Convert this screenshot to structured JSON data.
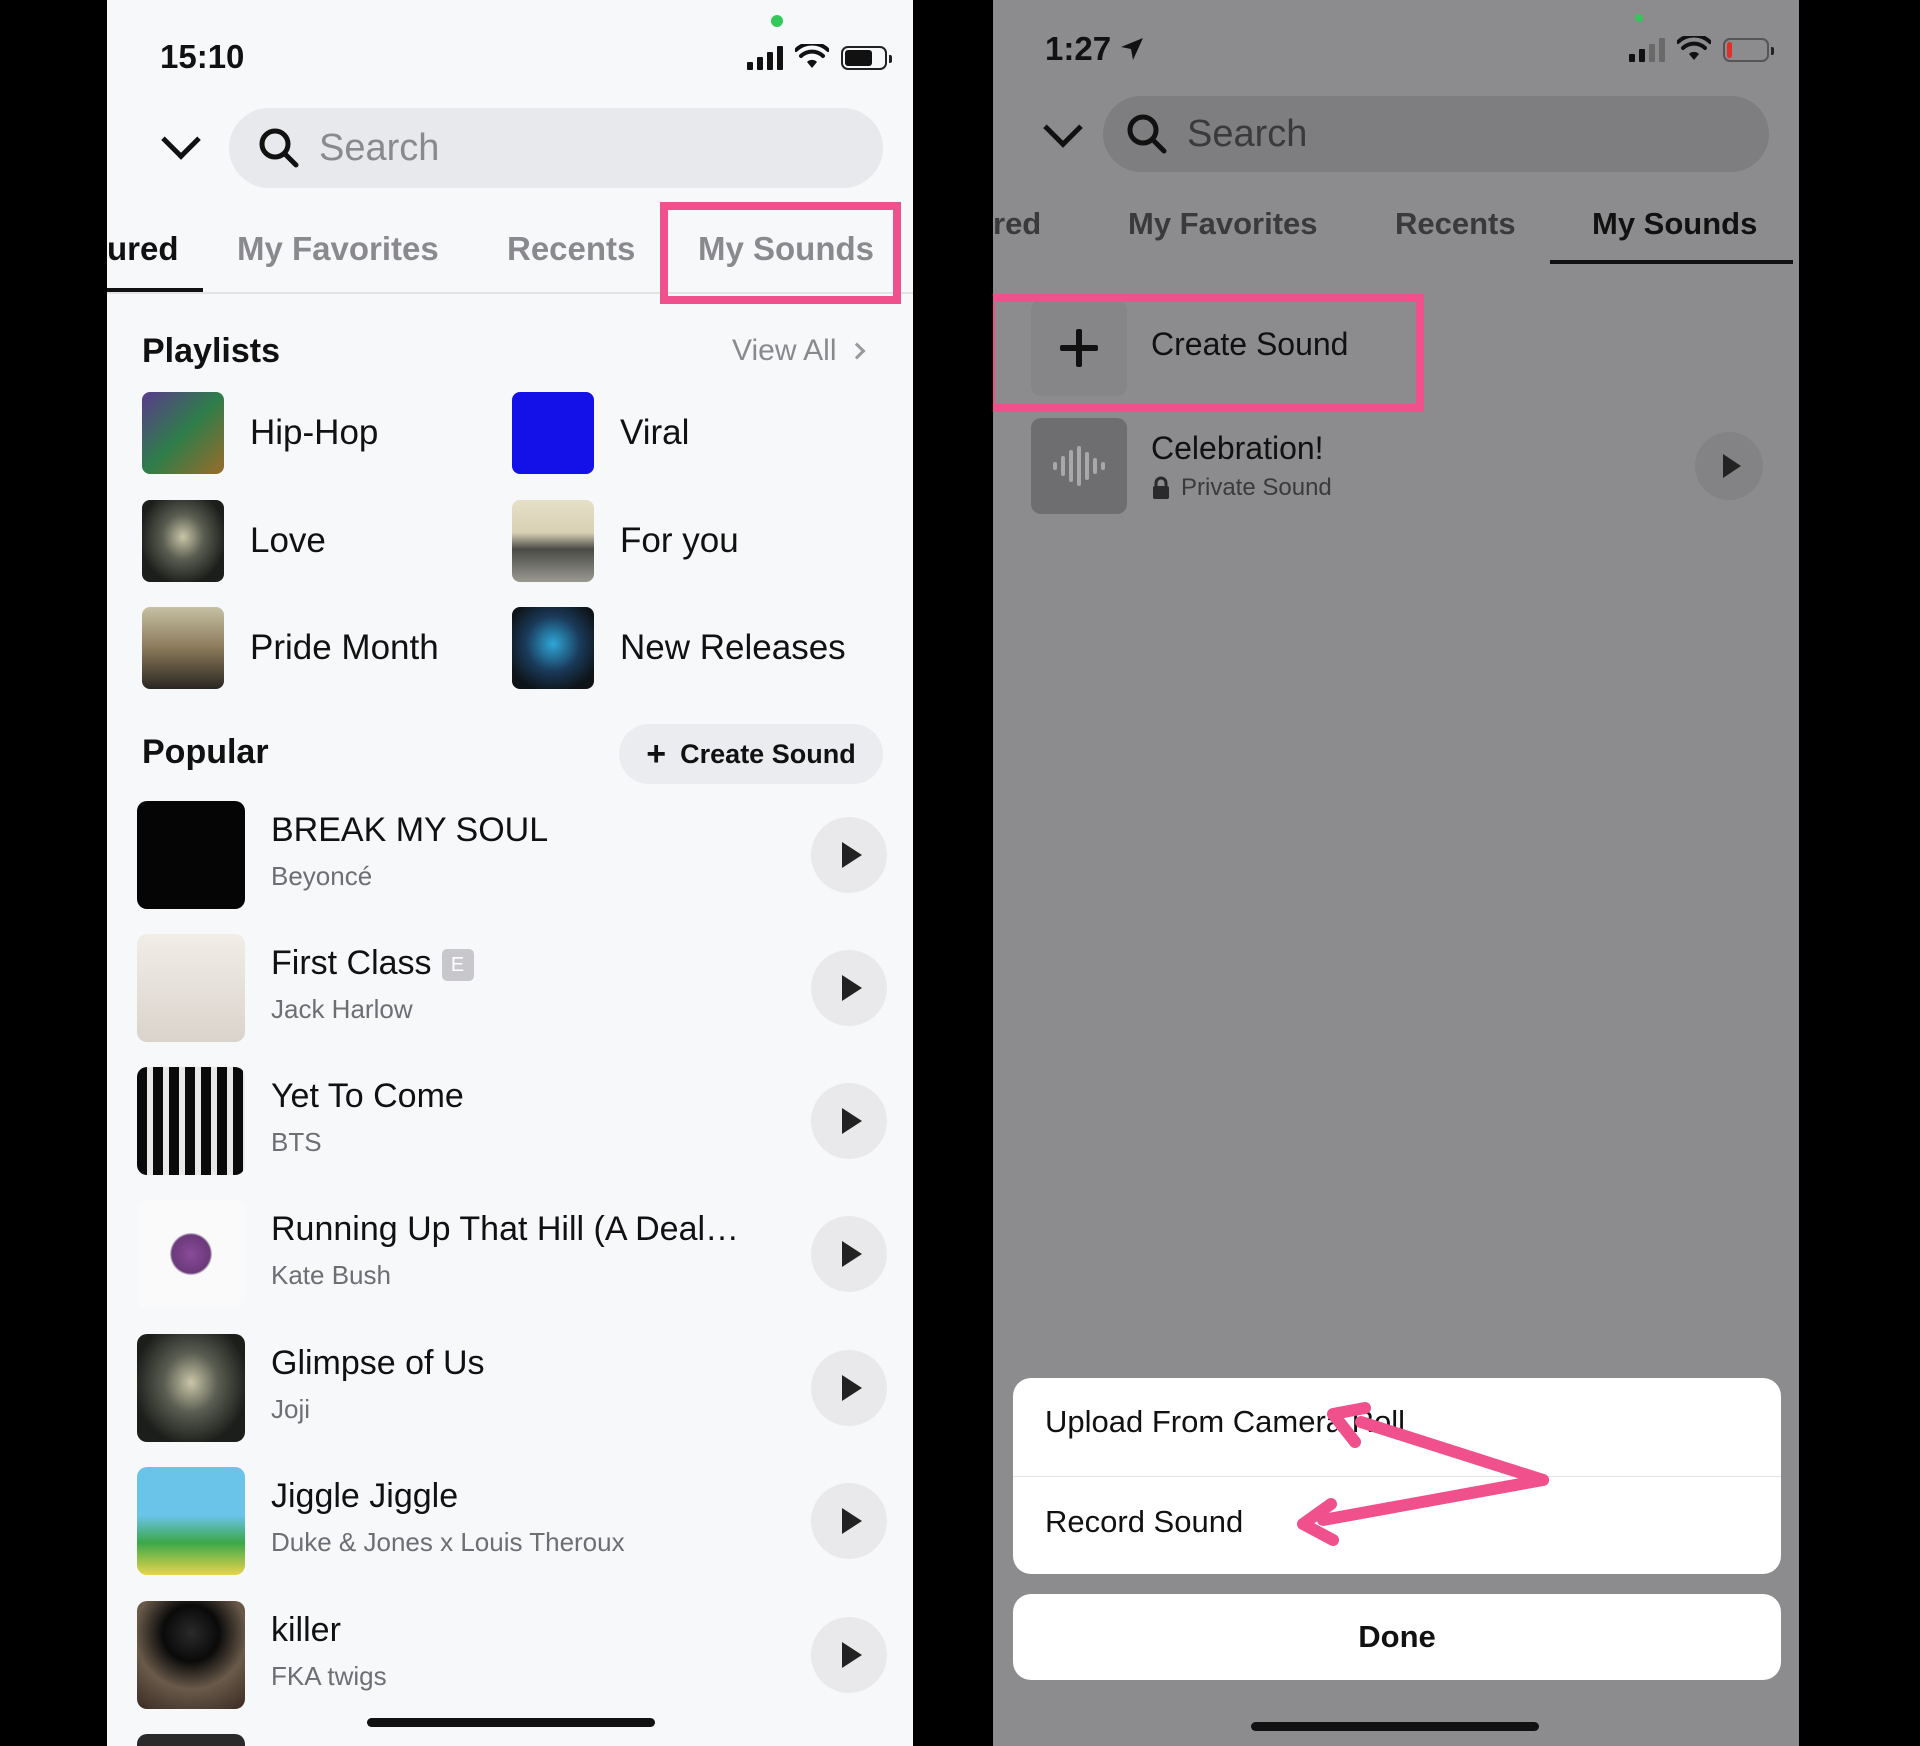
{
  "left": {
    "status": {
      "time": "15:10"
    },
    "search": {
      "placeholder": "Search"
    },
    "tabs": [
      {
        "label": "ured",
        "active": true
      },
      {
        "label": "My Favorites",
        "active": false
      },
      {
        "label": "Recents",
        "active": false
      },
      {
        "label": "My Sounds",
        "active": false
      }
    ],
    "playlists": {
      "title": "Playlists",
      "view_all": "View All",
      "items": [
        {
          "label": "Hip-Hop"
        },
        {
          "label": "Viral"
        },
        {
          "label": "Love"
        },
        {
          "label": "For you"
        },
        {
          "label": "Pride Month"
        },
        {
          "label": "New Releases"
        }
      ]
    },
    "popular": {
      "title": "Popular",
      "create_label": "Create Sound",
      "songs": [
        {
          "title": "BREAK MY SOUL",
          "artist": "Beyoncé"
        },
        {
          "title": "First Class",
          "artist": "Jack Harlow",
          "explicit": "E"
        },
        {
          "title": "Yet To Come",
          "artist": "BTS"
        },
        {
          "title": "Running Up That Hill (A Deal…",
          "artist": "Kate Bush"
        },
        {
          "title": "Glimpse of Us",
          "artist": "Joji"
        },
        {
          "title": "Jiggle Jiggle",
          "artist": "Duke & Jones x Louis Theroux"
        },
        {
          "title": "killer",
          "artist": "FKA twigs"
        }
      ]
    }
  },
  "right": {
    "status": {
      "time": "1:27"
    },
    "search": {
      "placeholder": "Search"
    },
    "tabs": [
      {
        "label": "red",
        "active": false
      },
      {
        "label": "My Favorites",
        "active": false
      },
      {
        "label": "Recents",
        "active": false
      },
      {
        "label": "My Sounds",
        "active": true
      }
    ],
    "create_sound": "Create Sound",
    "sound": {
      "title": "Celebration!",
      "subtitle": "Private Sound"
    },
    "sheet": {
      "upload": "Upload From Camera Roll",
      "record": "Record Sound",
      "done": "Done"
    }
  },
  "colors": {
    "highlight": "#f0508c",
    "green_dot": "#34c759"
  }
}
